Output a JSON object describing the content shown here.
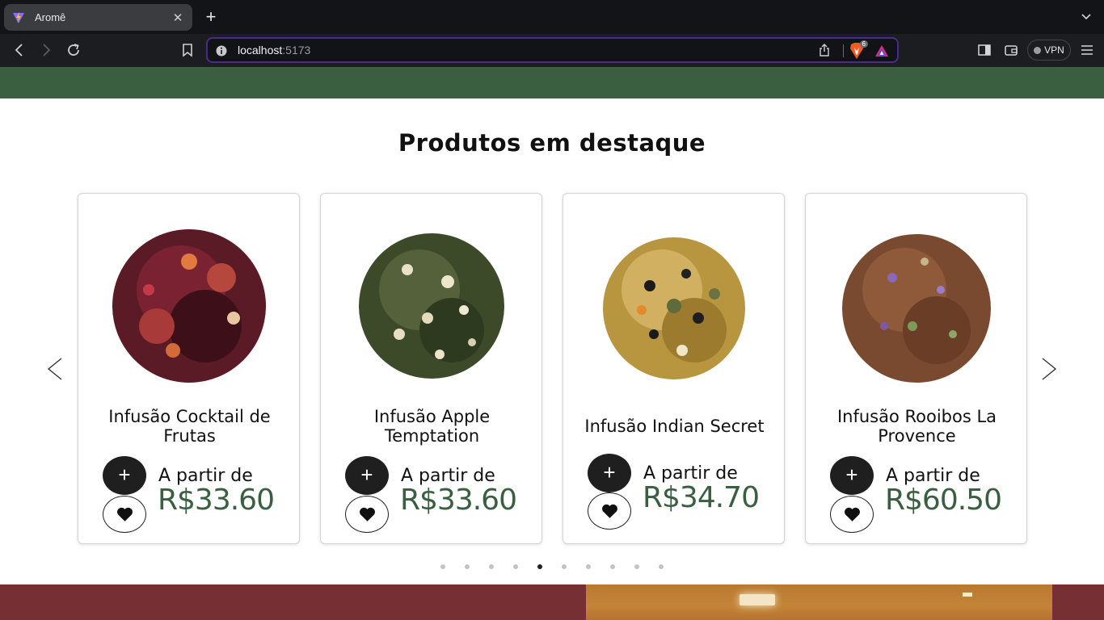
{
  "browser": {
    "tab_title": "Aromê",
    "url_host": "localhost",
    "url_port": ":5173",
    "shield_count": "6",
    "vpn_label": "VPN"
  },
  "section": {
    "title": "Produtos em destaque"
  },
  "products": [
    {
      "name": "Infusão Cocktail de Frutas",
      "price_label": "A partir de",
      "price": "R$33.60"
    },
    {
      "name": "Infusão Apple Temptation",
      "price_label": "A partir de",
      "price": "R$33.60"
    },
    {
      "name": "Infusão Indian Secret",
      "price_label": "A partir de",
      "price": "R$34.70"
    },
    {
      "name": "Infusão Rooibos La Provence",
      "price_label": "A partir de",
      "price": "R$60.50"
    }
  ],
  "carousel": {
    "total_pages": 10,
    "active_page": 5
  },
  "colors": {
    "brand_green": "#3a5f40",
    "brand_red": "#762f33"
  }
}
